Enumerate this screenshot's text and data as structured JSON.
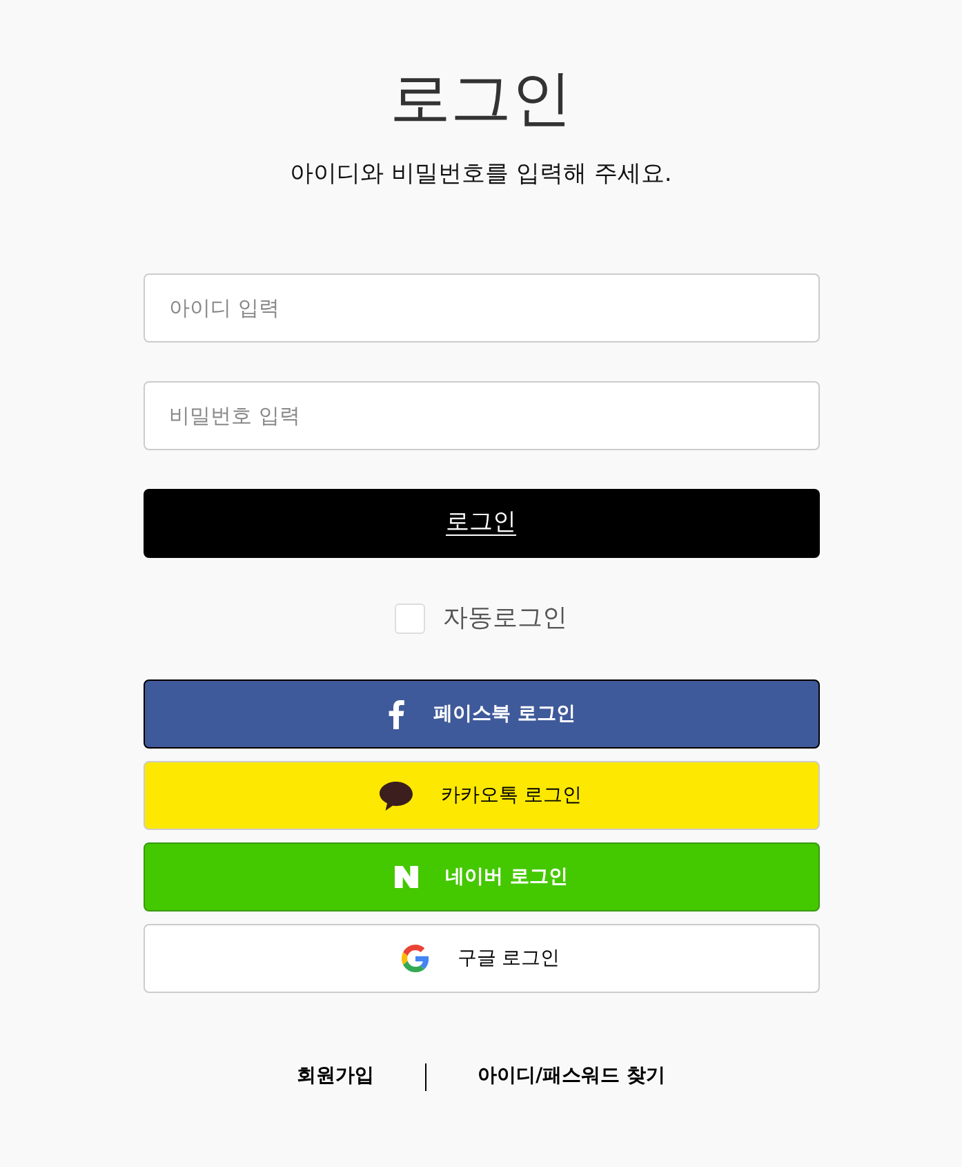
{
  "page": {
    "title": "로그인",
    "subtitle": "아이디와 비밀번호를 입력해 주세요."
  },
  "fields": [
    {
      "placeholder": "아이디 입력"
    },
    {
      "placeholder": "비밀번호 입력"
    }
  ],
  "login_button": {
    "label": "로그인"
  },
  "auto_login": {
    "label": "자동로그인",
    "checked": false
  },
  "social_logins": [
    {
      "kind": "facebook",
      "label": "페이스북 로그인"
    },
    {
      "kind": "kakao",
      "label": "카카오톡 로그인"
    },
    {
      "kind": "naver",
      "label": "네이버 로그인"
    },
    {
      "kind": "google",
      "label": "구글 로그인"
    }
  ],
  "footer_links": [
    "회원가입",
    "아이디/패스워드 찾기"
  ]
}
